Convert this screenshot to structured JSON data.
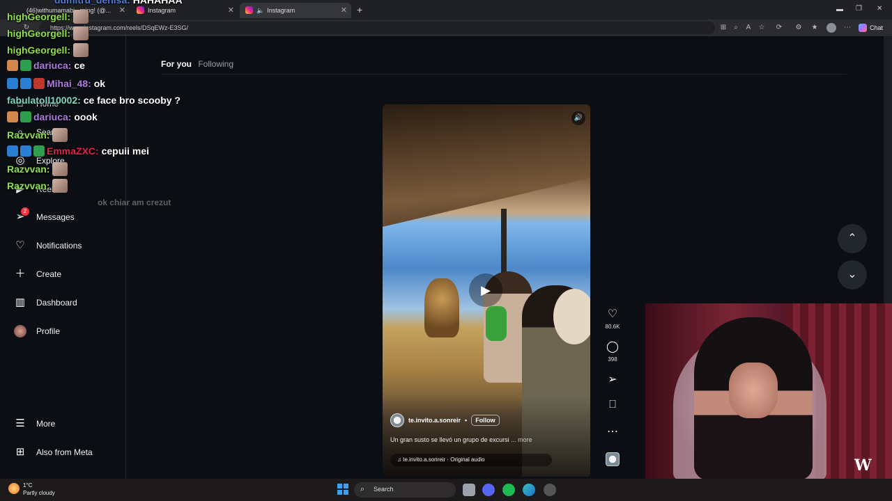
{
  "browser": {
    "tabs": [
      {
        "label": "(46)withumamabi...rning! (@..."
      },
      {
        "label": "Instagram"
      },
      {
        "label": "Instagram"
      }
    ],
    "url": "https://www.instagram.com/reels/DSqEWz-E3SG/",
    "chat_label": "Chat",
    "new_tab": "+"
  },
  "sidebar": {
    "items": [
      {
        "label": "Home",
        "icon": "home-icon"
      },
      {
        "label": "Search",
        "icon": "search-icon"
      },
      {
        "label": "Explore",
        "icon": "compass-icon"
      },
      {
        "label": "Reels",
        "icon": "reels-icon"
      },
      {
        "label": "Messages",
        "icon": "messages-icon",
        "badge": "2"
      },
      {
        "label": "Notifications",
        "icon": "heart-icon"
      },
      {
        "label": "Create",
        "icon": "plus-icon"
      },
      {
        "label": "Dashboard",
        "icon": "dashboard-icon"
      },
      {
        "label": "Profile",
        "icon": "profile-avatar"
      }
    ],
    "bottom": [
      {
        "label": "More",
        "icon": "menu-icon"
      },
      {
        "label": "Also from Meta",
        "icon": "meta-grid-icon"
      }
    ]
  },
  "feed": {
    "tab_for_you": "For you",
    "tab_following": "Following"
  },
  "reel": {
    "author": "te.invito.a.sonreir",
    "separator": "•",
    "follow": "Follow",
    "caption": "Un gran susto se llevó un grupo de excursi",
    "more": "... more",
    "audio": "te.invito.a.sonreir · Original audio",
    "likes": "80.6K",
    "comments": "398"
  },
  "chat_overlay": [
    {
      "user": "dumitru_denisa:",
      "msg": "HAHAHAA",
      "color": "#4a7bd6"
    },
    {
      "user": "highGeorgell:",
      "msg": "",
      "color": "#8ee04a"
    },
    {
      "user": "highGeorgell:",
      "msg": "",
      "color": "#8ee04a"
    },
    {
      "user": "highGeorgell:",
      "msg": "",
      "color": "#8ee04a"
    },
    {
      "user": "dariuca:",
      "msg": "ce",
      "color": "#b07be0"
    },
    {
      "user": "Mihai_48:",
      "msg": "ok",
      "color": "#b07be0"
    },
    {
      "user": "fabulatoll10002:",
      "msg": "ce face bro scooby ?",
      "color": "#7fd8c3"
    },
    {
      "user": "dariuca:",
      "msg": "oook",
      "color": "#b07be0"
    },
    {
      "user": "Razvvan:",
      "msg": "",
      "color": "#8ee04a"
    },
    {
      "user": "EmmaZXC:",
      "msg": "cepuii mei",
      "color": "#e0234a"
    },
    {
      "user": "Razvvan:",
      "msg": "",
      "color": "#8ee04a"
    },
    {
      "user": "Razvvan:",
      "msg": "",
      "color": "#8ee04a"
    },
    {
      "user": "",
      "msg": "ok chiar am crezut",
      "color": "#555"
    }
  ],
  "taskbar": {
    "temp": "1°C",
    "weather": "Partly cloudy",
    "search": "Search"
  },
  "colors": {
    "accent": "#0095f6",
    "background": "#0b0e13",
    "badge": "#ff3040"
  }
}
